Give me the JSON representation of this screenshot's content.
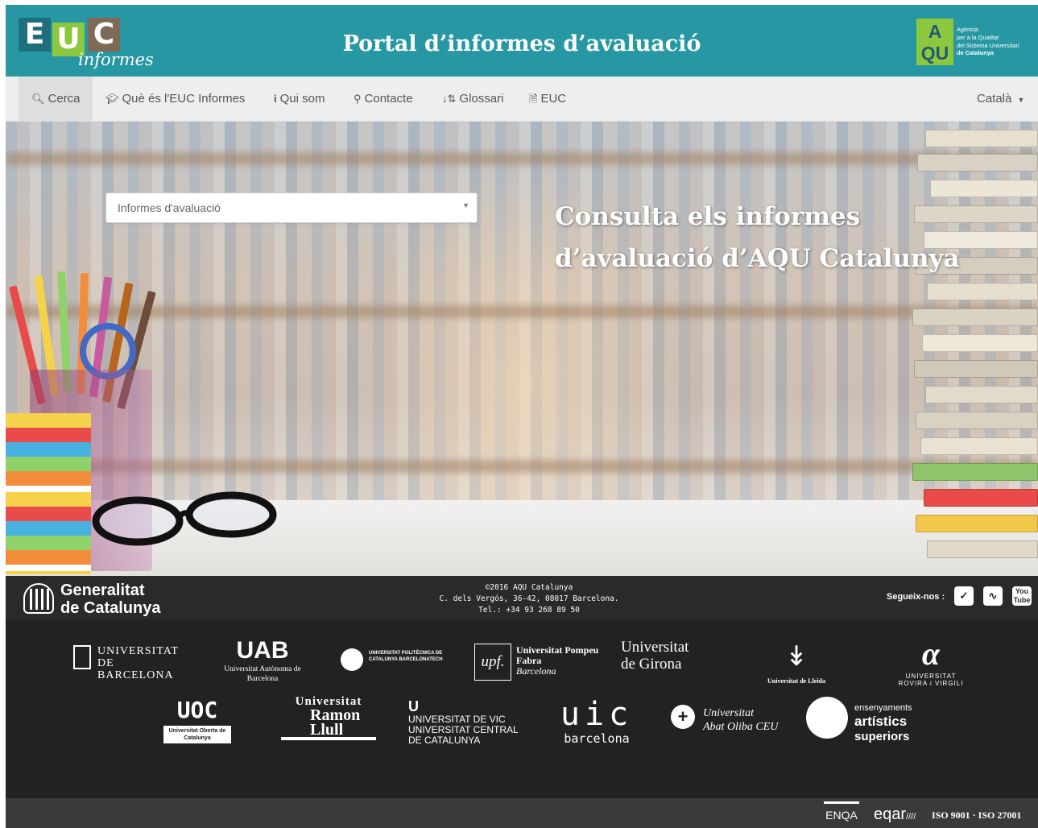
{
  "header": {
    "logo_letters": [
      "E",
      "U",
      "C"
    ],
    "logo_script": "informes",
    "title": "Portal d’informes d’avaluació",
    "aqu_mark_top": "A",
    "aqu_mark_bottom": "QU",
    "aqu_text_lines": [
      "Agència",
      "per a la Qualitat",
      "del Sistema Universitari",
      "de Catalunya"
    ]
  },
  "nav": {
    "items": [
      {
        "label": "Cerca",
        "icon": "search-icon"
      },
      {
        "label": "Què és l'EUC Informes",
        "icon": "graduation-cap-icon"
      },
      {
        "label": "Qui som",
        "icon": "info-icon"
      },
      {
        "label": "Contacte",
        "icon": "map-marker-icon"
      },
      {
        "label": "Glossari",
        "icon": "sort-alpha-icon"
      },
      {
        "label": "EUC",
        "icon": "document-icon"
      }
    ],
    "language": "Català"
  },
  "hero": {
    "select_value": "Informes d'avaluació",
    "title_line1": "Consulta els informes",
    "title_line2": "d’avaluació d’AQU Catalunya"
  },
  "footer": {
    "gencat_line1": "Generalitat",
    "gencat_line2": "de Catalunya",
    "copyright": "©2016 AQU Catalunya",
    "address": "C. dels Vergós, 36-42, 08017 Barcelona.",
    "phone": "Tel.: +34 93 268 89 50",
    "follow": "Segueix-nos :",
    "social": [
      "twitter-icon",
      "rss-icon",
      "youtube-icon"
    ]
  },
  "universities": {
    "ub": "UNIVERSITAT DE BARCELONA",
    "uab_mark": "UAB",
    "uab_sub": "Universitat Autònoma de Barcelona",
    "upc": "UNIVERSITAT POLITÈCNICA DE CATALUNYA BARCELONATECH",
    "upf_mark": "upf.",
    "upf_text": "Universitat Pompeu Fabra",
    "upf_city": "Barcelona",
    "udg1": "Universitat",
    "udg2": "de Girona",
    "udl": "Universitat de Lleida",
    "urv": "UNIVERSITAT ROVIRA i VIRGILI",
    "uoc_mark": "UOC",
    "uoc_sub": "Universitat Oberta de Catalunya",
    "url1": "Universitat",
    "url2": "Ramon",
    "url3": "Llull",
    "uvic1": "UNIVERSITAT DE VIC",
    "uvic2": "UNIVERSITAT CENTRAL",
    "uvic3": "DE CATALUNYA",
    "uic_mark": "uic",
    "uic_sub": "barcelona",
    "uao1": "Universitat",
    "uao2": "Abat Oliba CEU",
    "eas1": "ensenyaments",
    "eas2": "artístics",
    "eas3": "superiors"
  },
  "bottom": {
    "enqa": "ENQA",
    "eqar": "eqar",
    "iso": "ISO 9001 · ISO 27001"
  },
  "colors": {
    "header_bg": "#2798a3",
    "nav_bg": "#eeeeee",
    "footer_bg": "#222222",
    "accent_green": "#8dc63f"
  }
}
